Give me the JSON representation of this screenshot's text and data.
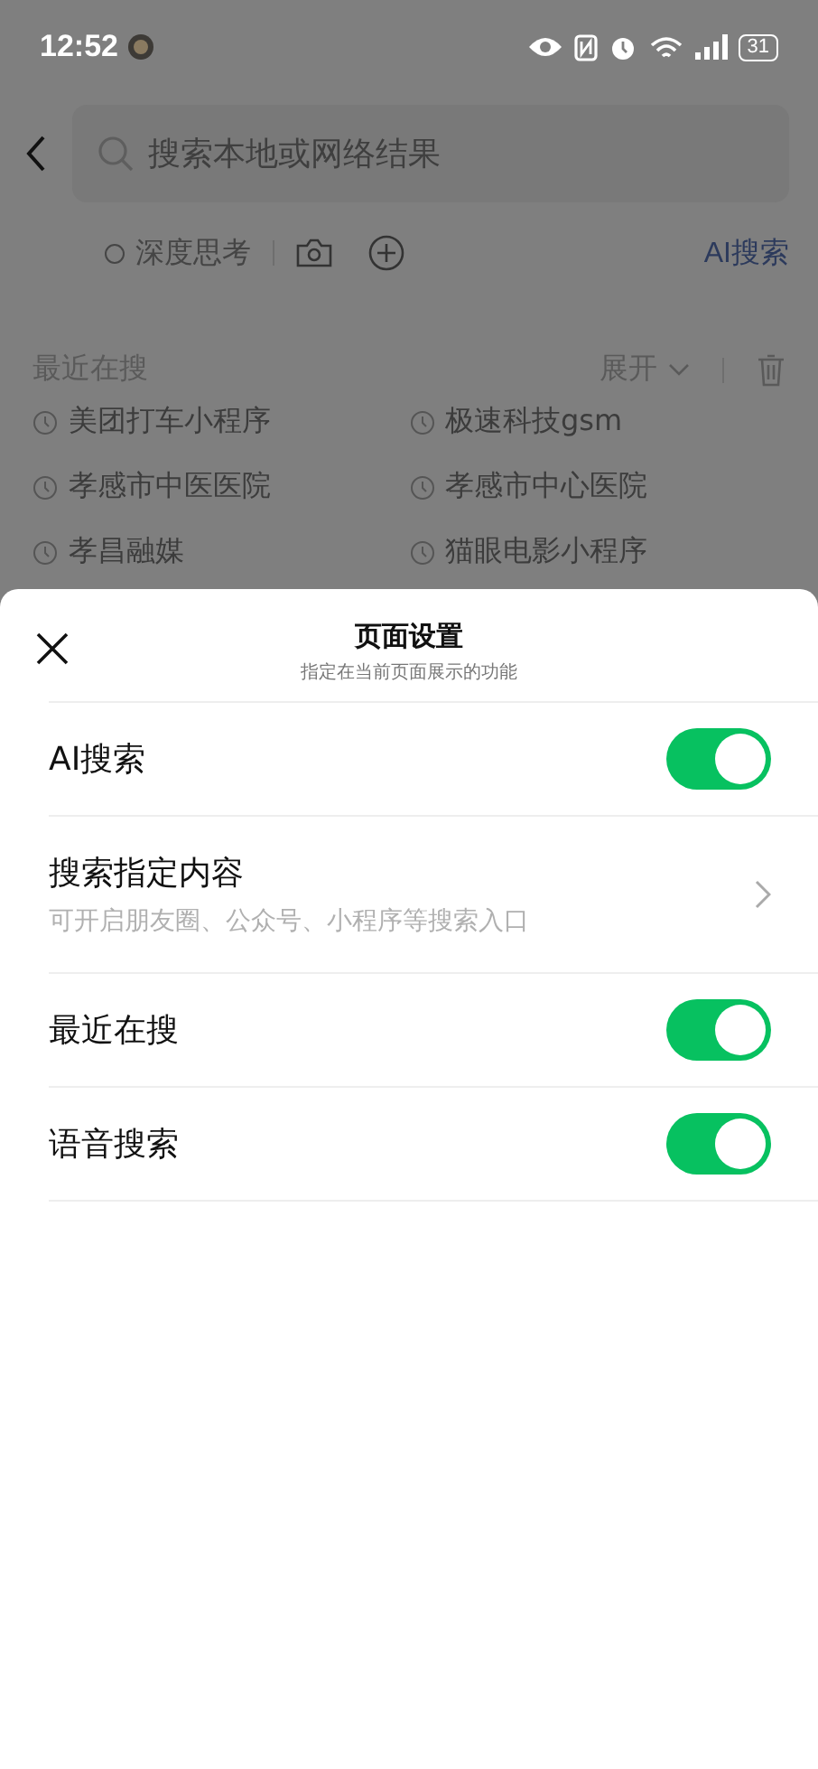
{
  "status_bar": {
    "time": "12:52",
    "battery": "31"
  },
  "search": {
    "placeholder": "搜索本地或网络结果"
  },
  "options": {
    "deep_think": {
      "label": "深度思考",
      "checked": false
    },
    "ai_link": "AI搜索"
  },
  "recent": {
    "title": "最近在搜",
    "expand": "展开",
    "items": [
      "美团打车小程序",
      "极速科技gsm",
      "孝感市中医医院",
      "孝感市中心医院",
      "孝昌融媒",
      "猫眼电影小程序"
    ]
  },
  "sheet": {
    "title": "页面设置",
    "subtitle": "指定在当前页面展示的功能",
    "rows": [
      {
        "kind": "toggle",
        "label": "AI搜索",
        "on": true
      },
      {
        "kind": "link",
        "label": "搜索指定内容",
        "hint": "可开启朋友圈、公众号、小程序等搜索入口"
      },
      {
        "kind": "toggle",
        "label": "最近在搜",
        "on": true
      },
      {
        "kind": "toggle",
        "label": "语音搜索",
        "on": true
      }
    ]
  }
}
